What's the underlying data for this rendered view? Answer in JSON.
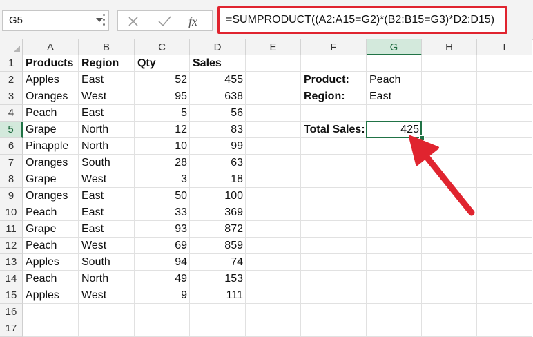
{
  "name_box": {
    "value": "G5"
  },
  "formula_bar": {
    "icons": [
      "cancel-icon",
      "enter-icon",
      "fx-icon"
    ],
    "fx_label": "fx",
    "formula": "=SUMPRODUCT((A2:A15=G2)*(B2:B15=G3)*D2:D15)"
  },
  "columns": [
    "A",
    "B",
    "C",
    "D",
    "E",
    "F",
    "G",
    "H",
    "I"
  ],
  "rows": [
    "1",
    "2",
    "3",
    "4",
    "5",
    "6",
    "7",
    "8",
    "9",
    "10",
    "11",
    "12",
    "13",
    "14",
    "15",
    "16",
    "17"
  ],
  "headers": {
    "products": "Products",
    "region": "Region",
    "qty": "Qty",
    "sales": "Sales"
  },
  "table": [
    {
      "product": "Apples",
      "region": "East",
      "qty": "52",
      "sales": "455"
    },
    {
      "product": "Oranges",
      "region": "West",
      "qty": "95",
      "sales": "638"
    },
    {
      "product": "Peach",
      "region": "East",
      "qty": "5",
      "sales": "56"
    },
    {
      "product": "Grape",
      "region": "North",
      "qty": "12",
      "sales": "83"
    },
    {
      "product": "Pinapple",
      "region": "North",
      "qty": "10",
      "sales": "99"
    },
    {
      "product": "Oranges",
      "region": "South",
      "qty": "28",
      "sales": "63"
    },
    {
      "product": "Grape",
      "region": "West",
      "qty": "3",
      "sales": "18"
    },
    {
      "product": "Oranges",
      "region": "East",
      "qty": "50",
      "sales": "100"
    },
    {
      "product": "Peach",
      "region": "East",
      "qty": "33",
      "sales": "369"
    },
    {
      "product": "Grape",
      "region": "East",
      "qty": "93",
      "sales": "872"
    },
    {
      "product": "Peach",
      "region": "West",
      "qty": "69",
      "sales": "859"
    },
    {
      "product": "Apples",
      "region": "South",
      "qty": "94",
      "sales": "74"
    },
    {
      "product": "Peach",
      "region": "North",
      "qty": "49",
      "sales": "153"
    },
    {
      "product": "Apples",
      "region": "West",
      "qty": "9",
      "sales": "111"
    }
  ],
  "criteria": {
    "product_label": "Product:",
    "product_value": "Peach",
    "region_label": "Region:",
    "region_value": "East",
    "total_label": "Total Sales:",
    "total_value": "425"
  },
  "selection": {
    "active_cell": "G5",
    "active_column": "G",
    "active_row": "5"
  },
  "colors": {
    "accent": "#217346",
    "highlight": "#e0242f"
  }
}
